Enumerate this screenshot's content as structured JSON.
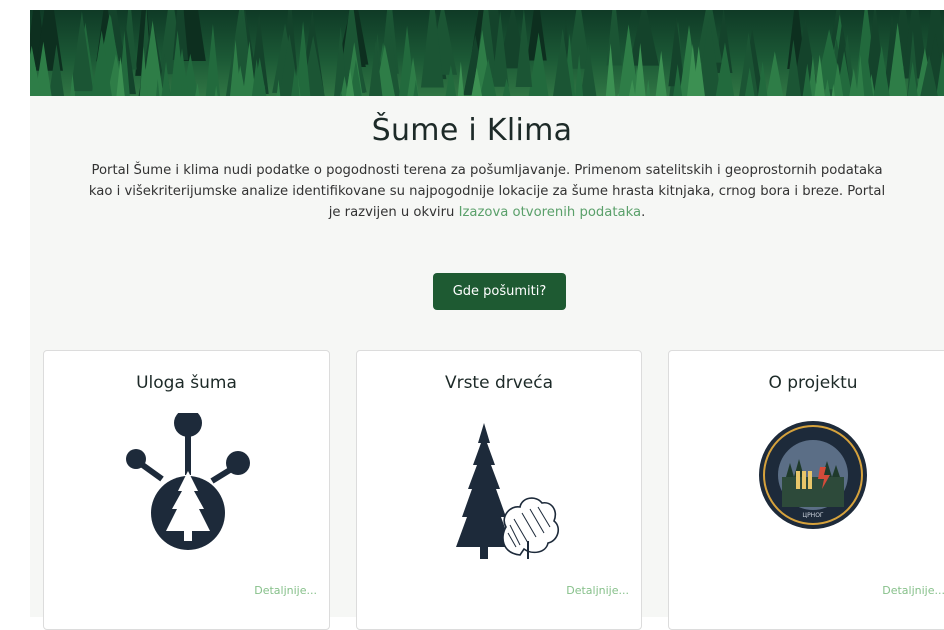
{
  "page": {
    "title": "Šume i Klima",
    "description_lines": [
      "Portal Šume i klima nudi podatke o pogodnosti terena za pošumljavanje. Primenom satelitskih i geoprostornih podataka",
      "kao i višekriterijumske analize identifikovane su najpogodnije lokacije za šume hrasta kitnjaka, crnog bora i breze. Portal"
    ],
    "description_line3_prefix": "je razvijen u okviru ",
    "description_link": "Izazova otvorenih podataka",
    "description_line3_suffix": ".",
    "cta_label": "Gde pošumiti?"
  },
  "cards": [
    {
      "title": "Uloga šuma",
      "link": "Detaljnije...",
      "icon": "forest-role-icon"
    },
    {
      "title": "Vrste drveća",
      "link": "Detaljnije...",
      "icon": "tree-species-icon"
    },
    {
      "title": "O projektu",
      "link": "Detaljnije...",
      "icon": "project-logo-icon"
    }
  ],
  "colors": {
    "primary": "#1e5a32",
    "link": "#5aa06a",
    "panel": "#f6f7f5",
    "icon": "#1d2a3a"
  }
}
